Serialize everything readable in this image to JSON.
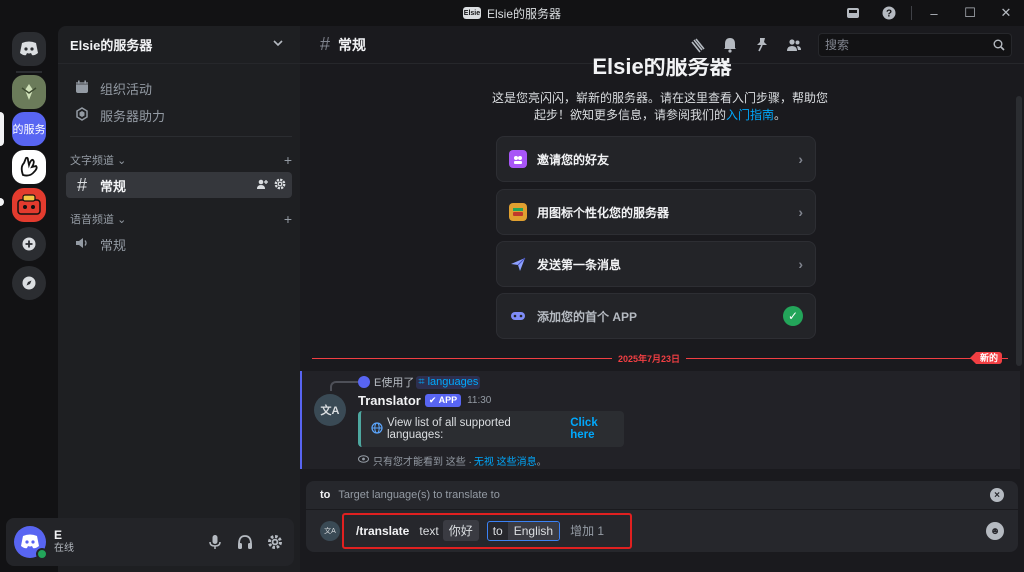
{
  "titlebar": {
    "server_badge": "Elsie",
    "title": "Elsie的服务器",
    "buttons": [
      "inbox-icon",
      "help-icon",
      "minimize-icon",
      "maximize-icon",
      "close-icon"
    ]
  },
  "guilds": {
    "items": [
      {
        "name": "discord-home",
        "color": "#5865f2"
      },
      {
        "name": "plant-server",
        "color": "#6b7b5a"
      },
      {
        "name": "elsie-server",
        "label": "的服务",
        "color": "#5865f2",
        "selected": true
      },
      {
        "name": "hand-server",
        "color": "#ffffff"
      },
      {
        "name": "red-server",
        "color": "#e33b2e"
      },
      {
        "name": "add-server"
      },
      {
        "name": "explore-servers"
      }
    ]
  },
  "sidebar": {
    "server_name": "Elsie的服务器",
    "top_items": [
      {
        "label": "组织活动",
        "icon": "calendar-icon"
      },
      {
        "label": "服务器助力",
        "icon": "boost-icon"
      }
    ],
    "categories": [
      {
        "label": "文字频道",
        "channels": [
          {
            "label": "常规",
            "icon": "hash-icon",
            "selected": true
          }
        ]
      },
      {
        "label": "语音频道",
        "channels": [
          {
            "label": "常规",
            "icon": "speaker-icon"
          }
        ]
      }
    ]
  },
  "user": {
    "name": "E",
    "status": "在线",
    "status_color": "#23a55a"
  },
  "channel": {
    "name": "常规",
    "search_placeholder": "搜索"
  },
  "welcome": {
    "title": "Elsie的服务器",
    "desc_main": "这是您亮闪闪，崭新的服务器。请在这里查看入门步骤，帮助您起步！欲知更多信息，请参阅我们的",
    "desc_link": "入门指南",
    "desc_end": "。",
    "actions": [
      {
        "label": "邀请您的好友",
        "icon_color": "#a855f7",
        "done": false
      },
      {
        "label": "用图标个性化您的服务器",
        "icon_color": "#e0a030",
        "done": false
      },
      {
        "label": "发送第一条消息",
        "icon_color": "#6b7bff",
        "done": false
      },
      {
        "label": "添加您的首个 APP",
        "icon_color": "#5865f2",
        "done": true
      }
    ]
  },
  "divider": {
    "date": "2025年7月23日",
    "new_label": "新的"
  },
  "message": {
    "reply_user": "E使用了",
    "reply_cmd": "languages",
    "bot_name": "Translator",
    "app_tag": "✔ APP",
    "time": "11:30",
    "bot_avatar_text": "文A",
    "embed_text": "View list of all supported languages:",
    "embed_link": "Click here",
    "ephemeral_text": "只有您才能看到 这些 ·",
    "ephemeral_link": "无视 这些消息",
    "ephemeral_end": "。"
  },
  "composer": {
    "option_hint_key": "to",
    "option_hint_desc": "Target language(s) to translate to",
    "command": "/translate",
    "opt1_key": "text",
    "opt1_val": "你好",
    "opt2_key": "to",
    "opt2_val": "English",
    "extra": "增加 1"
  }
}
